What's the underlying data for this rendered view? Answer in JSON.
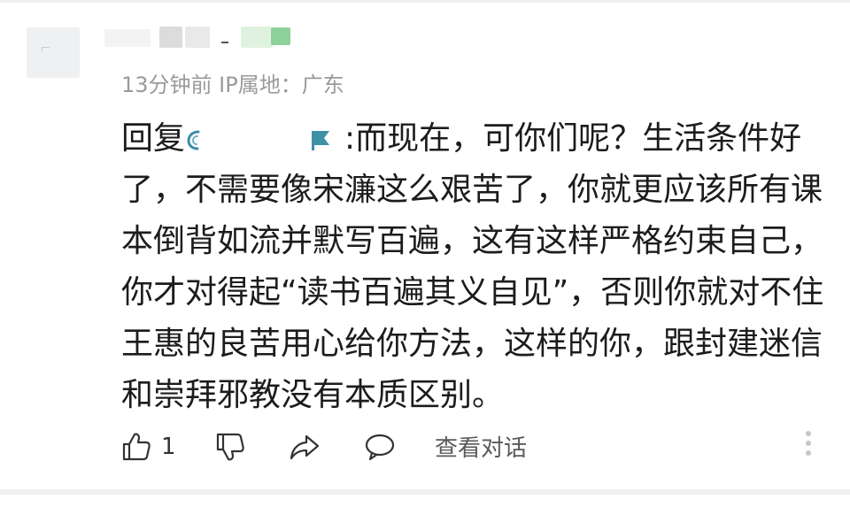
{
  "comment": {
    "meta_text": "13分钟前 IP属地：广东",
    "reply_prefix": "回复",
    "reply_after_mention": ":而现在，可你们呢？生活条件好",
    "reply_lines": [
      "了，不需要像宋濂这么艰苦了，你就更应该所有课",
      "本倒背如流并默写百遍，这有这样严格约束自己，",
      "你才对得起“读书百遍其义自见”，否则你就对不住",
      "王惠的良苦用心给你方法，这样的你，跟封建迷信",
      "和崇拜邪教没有本质区别。"
    ]
  },
  "actions": {
    "like_count": "1",
    "view_conversation_label": "查看对话"
  },
  "icons": {
    "like": "thumbs-up-icon",
    "dislike": "thumbs-down-icon",
    "share": "share-icon",
    "comment": "comment-bubble-icon",
    "more": "more-vertical-icon"
  },
  "colors": {
    "meta": "#9a9a9a",
    "text": "#1c1c1c",
    "mention_accent": "#3a8ea8"
  }
}
